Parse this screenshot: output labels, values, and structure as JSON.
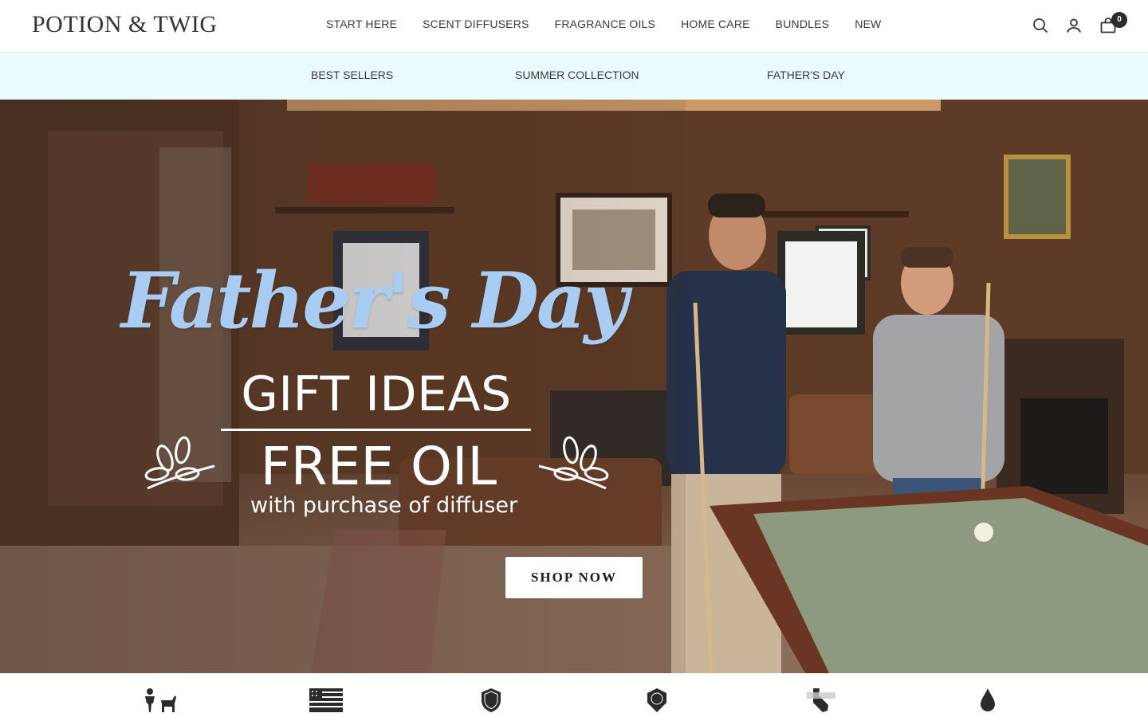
{
  "brand": {
    "logo": "POTION & TWIG"
  },
  "nav": {
    "items": [
      "START HERE",
      "SCENT DIFFUSERS",
      "FRAGRANCE OILS",
      "HOME CARE",
      "BUNDLES",
      "NEW"
    ]
  },
  "header_icons": {
    "search": "search-icon",
    "account": "user-icon",
    "cart": "cart-icon",
    "cart_count": "0"
  },
  "subnav": {
    "items": [
      "BEST SELLERS",
      "SUMMER COLLECTION",
      "FATHER'S DAY"
    ]
  },
  "hero": {
    "script_title": "Father's Day",
    "title": "GIFT IDEAS",
    "offer": "FREE OIL",
    "offer_sub": "with purchase of diffuser",
    "cta": "SHOP NOW",
    "colors": {
      "script": "#a9cdf2",
      "text": "#ffffff"
    }
  },
  "trust_bar": {
    "icons": [
      "family-pet-icon",
      "american-flag-icon",
      "ema-shield-icon",
      "ifra-badge-icon",
      "california-prop65-icon",
      "water-drop-icon"
    ]
  },
  "colors": {
    "subnav_bg": "#e9fbfd",
    "text": "#3a3a3a",
    "badge": "#2b2b2b"
  }
}
